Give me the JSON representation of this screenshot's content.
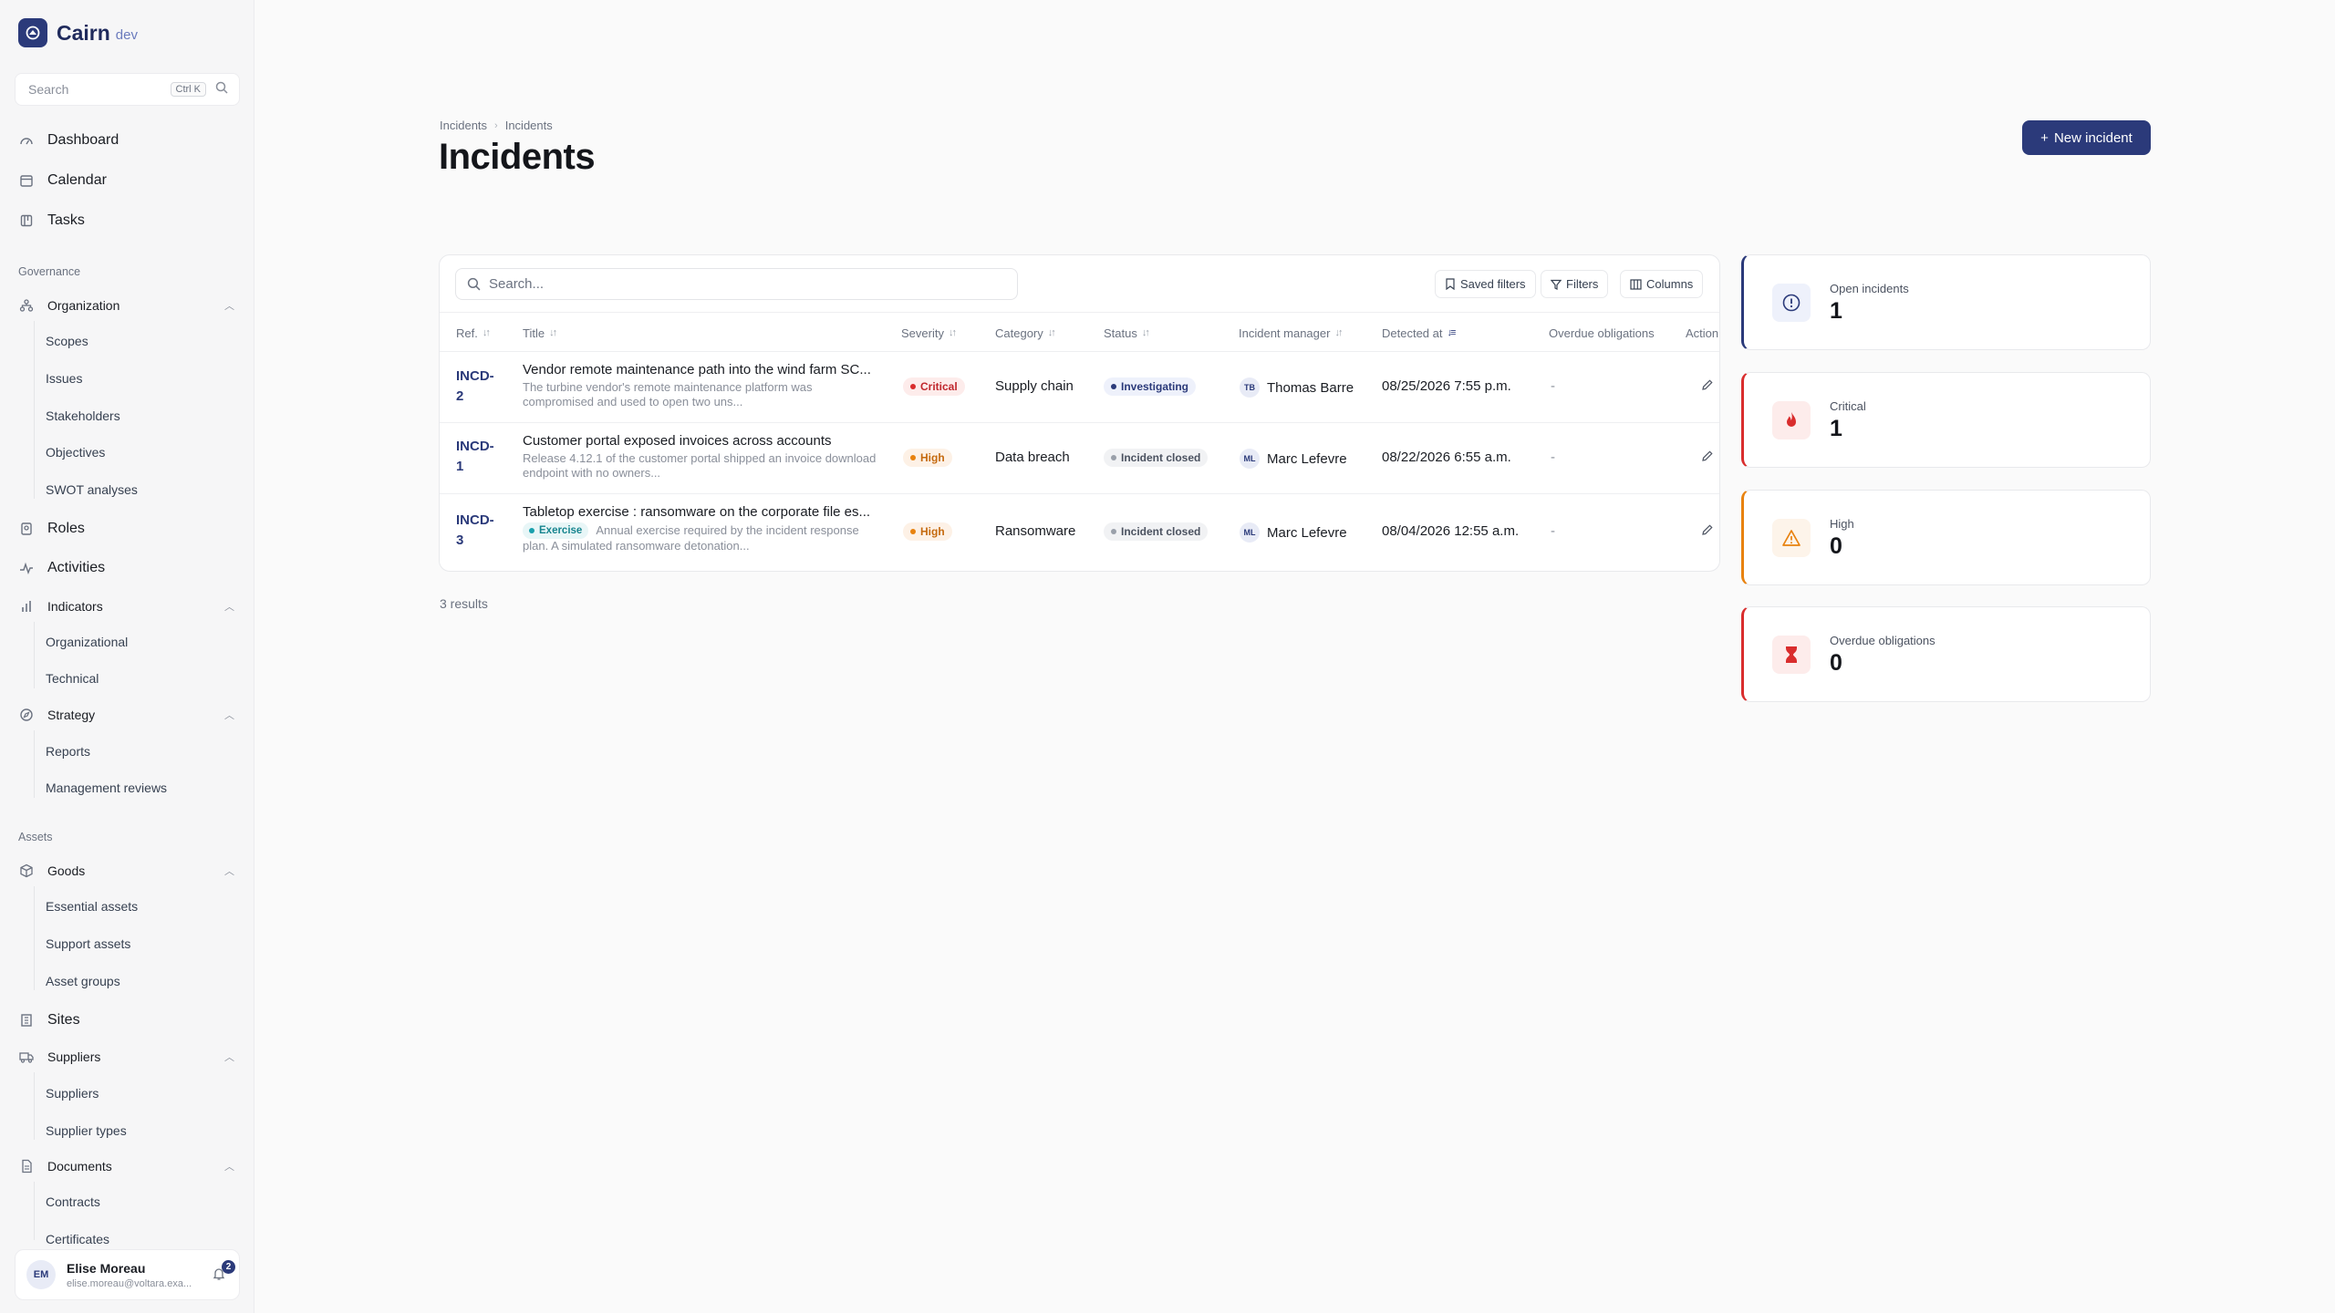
{
  "brand": {
    "name": "Cairn",
    "env": "dev"
  },
  "sidebar": {
    "search_placeholder": "Search",
    "search_shortcut": "Ctrl K",
    "top_items": [
      {
        "label": "Dashboard",
        "icon": "dashboard-icon"
      },
      {
        "label": "Calendar",
        "icon": "calendar-icon"
      },
      {
        "label": "Tasks",
        "icon": "tasks-icon"
      }
    ],
    "group_governance": "Governance",
    "organization": {
      "label": "Organization",
      "children": [
        "Scopes",
        "Issues",
        "Stakeholders",
        "Objectives",
        "SWOT analyses"
      ]
    },
    "roles": "Roles",
    "activities": "Activities",
    "indicators": {
      "label": "Indicators",
      "children": [
        "Organizational",
        "Technical"
      ]
    },
    "strategy": {
      "label": "Strategy",
      "children": [
        "Reports",
        "Management reviews"
      ]
    },
    "group_assets": "Assets",
    "goods": {
      "label": "Goods",
      "children": [
        "Essential assets",
        "Support assets",
        "Asset groups"
      ]
    },
    "sites": "Sites",
    "suppliers": {
      "label": "Suppliers",
      "children": [
        "Suppliers",
        "Supplier types"
      ]
    },
    "documents": {
      "label": "Documents",
      "children": [
        "Contracts",
        "Certificates"
      ]
    },
    "user": {
      "initials": "EM",
      "name": "Elise Moreau",
      "email": "elise.moreau@voltara.exa...",
      "notifications": "2"
    }
  },
  "header": {
    "breadcrumb": [
      "Incidents",
      "Incidents"
    ],
    "title": "Incidents",
    "new_button": "New incident"
  },
  "table": {
    "search_placeholder": "Search...",
    "saved_filters": "Saved filters",
    "filters": "Filters",
    "columns_btn": "Columns",
    "columns": [
      "Ref.",
      "Title",
      "Severity",
      "Category",
      "Status",
      "Incident manager",
      "Detected at",
      "Overdue obligations",
      "Action"
    ],
    "rows": [
      {
        "ref_a": "INCD-",
        "ref_b": "2",
        "title": "Vendor remote maintenance path into the wind farm SC...",
        "exercise": "",
        "desc": "The turbine vendor's remote maintenance platform was compromised and used to open two uns...",
        "severity": "Critical",
        "category": "Supply chain",
        "status": "Investigating",
        "manager_initials": "TB",
        "manager": "Thomas Barre",
        "detected": "08/25/2026 7:55 p.m.",
        "overdue": "-"
      },
      {
        "ref_a": "INCD-",
        "ref_b": "1",
        "title": "Customer portal exposed invoices across accounts",
        "exercise": "",
        "desc": "Release 4.12.1 of the customer portal shipped an invoice download endpoint with no owners...",
        "severity": "High",
        "category": "Data breach",
        "status": "Incident closed",
        "manager_initials": "ML",
        "manager": "Marc Lefevre",
        "detected": "08/22/2026 6:55 a.m.",
        "overdue": "-"
      },
      {
        "ref_a": "INCD-",
        "ref_b": "3",
        "title": "Tabletop exercise : ransomware on the corporate file es...",
        "exercise": "Exercise",
        "desc": "Annual exercise required by the incident response plan. A simulated ransomware detonation...",
        "severity": "High",
        "category": "Ransomware",
        "status": "Incident closed",
        "manager_initials": "ML",
        "manager": "Marc Lefevre",
        "detected": "08/04/2026 12:55 a.m.",
        "overdue": "-"
      }
    ],
    "results": "3 results"
  },
  "stats": [
    {
      "label": "Open incidents",
      "value": "1",
      "icon": "alert-circle-icon",
      "accent": "#2b3a7a"
    },
    {
      "label": "Critical",
      "value": "1",
      "icon": "flame-icon",
      "accent": "#d92d2d"
    },
    {
      "label": "High",
      "value": "0",
      "icon": "warning-triangle-icon",
      "accent": "#e8820f"
    },
    {
      "label": "Overdue obligations",
      "value": "0",
      "icon": "hourglass-icon",
      "accent": "#d92d2d"
    }
  ]
}
